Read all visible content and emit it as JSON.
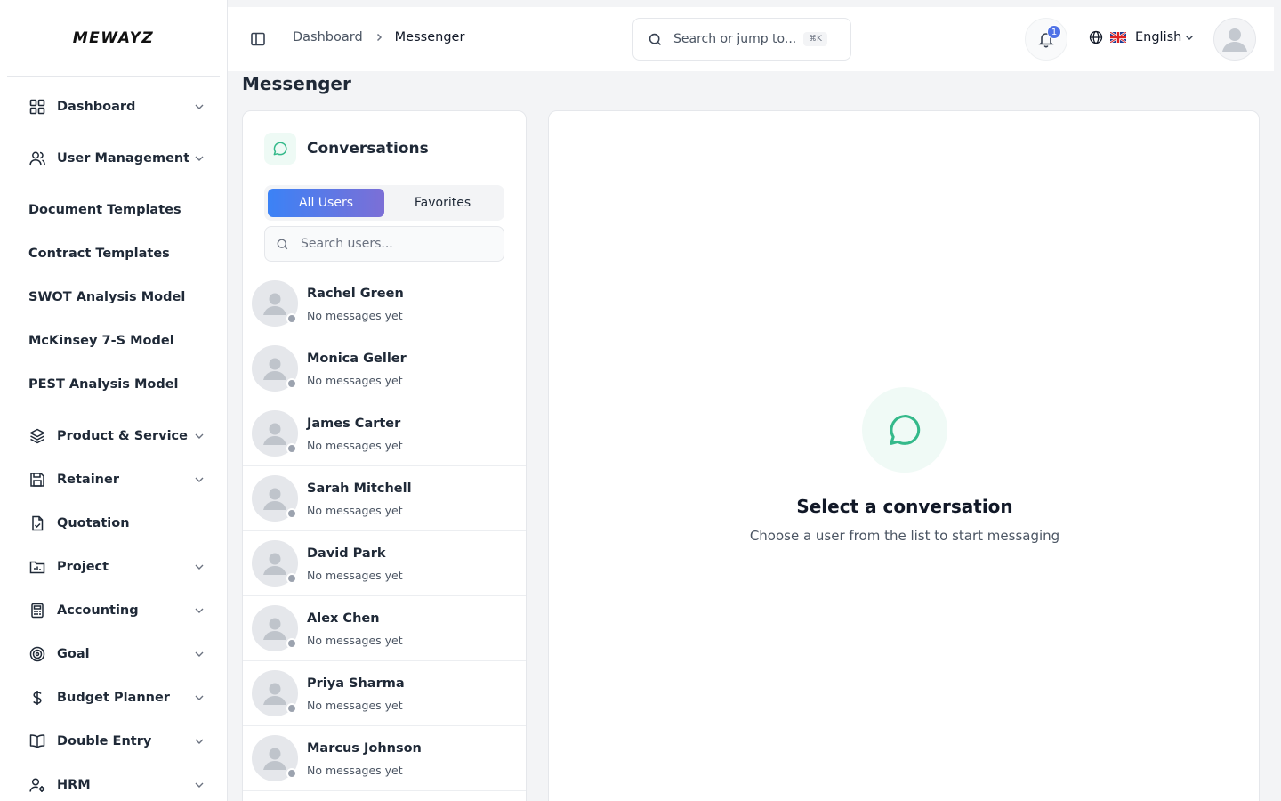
{
  "brand": {
    "name": "MEWAYZ"
  },
  "sidebar": {
    "items": [
      {
        "label": "Dashboard",
        "icon": "grid-icon",
        "has_chevron": true
      },
      {
        "label": "User Management",
        "icon": "users-icon",
        "has_chevron": true
      },
      {
        "label": "Document Templates",
        "icon": "",
        "has_chevron": false
      },
      {
        "label": "Contract Templates",
        "icon": "",
        "has_chevron": false
      },
      {
        "label": "SWOT Analysis Model",
        "icon": "",
        "has_chevron": false
      },
      {
        "label": "McKinsey 7-S Model",
        "icon": "",
        "has_chevron": false
      },
      {
        "label": "PEST Analysis Model",
        "icon": "",
        "has_chevron": false
      },
      {
        "label": "Product & Service",
        "icon": "layers-icon",
        "has_chevron": true
      },
      {
        "label": "Retainer",
        "icon": "save-icon",
        "has_chevron": true
      },
      {
        "label": "Quotation",
        "icon": "file-check-icon",
        "has_chevron": false
      },
      {
        "label": "Project",
        "icon": "folder-chart-icon",
        "has_chevron": true
      },
      {
        "label": "Accounting",
        "icon": "calculator-icon",
        "has_chevron": true
      },
      {
        "label": "Goal",
        "icon": "target-icon",
        "has_chevron": true
      },
      {
        "label": "Budget Planner",
        "icon": "dollar-icon",
        "has_chevron": true
      },
      {
        "label": "Double Entry",
        "icon": "book-icon",
        "has_chevron": true
      },
      {
        "label": "HRM",
        "icon": "user-gear-icon",
        "has_chevron": true
      }
    ]
  },
  "header": {
    "breadcrumb": [
      "Dashboard",
      "Messenger"
    ],
    "search_placeholder": "Search or jump to...",
    "search_shortcut": "⌘K",
    "notification_count": "1",
    "language": "English"
  },
  "page": {
    "title": "Messenger"
  },
  "conversations": {
    "title": "Conversations",
    "tabs": [
      {
        "label": "All Users",
        "active": true
      },
      {
        "label": "Favorites",
        "active": false
      }
    ],
    "search_placeholder": "Search users...",
    "users": [
      {
        "name": "Rachel Green",
        "last_message": "No messages yet"
      },
      {
        "name": "Monica Geller",
        "last_message": "No messages yet"
      },
      {
        "name": "James Carter",
        "last_message": "No messages yet"
      },
      {
        "name": "Sarah Mitchell",
        "last_message": "No messages yet"
      },
      {
        "name": "David Park",
        "last_message": "No messages yet"
      },
      {
        "name": "Alex Chen",
        "last_message": "No messages yet"
      },
      {
        "name": "Priya Sharma",
        "last_message": "No messages yet"
      },
      {
        "name": "Marcus Johnson",
        "last_message": "No messages yet"
      }
    ]
  },
  "chat": {
    "empty_title": "Select a conversation",
    "empty_subtitle": "Choose a user from the list to start messaging"
  },
  "colors": {
    "accent": "#3b82f6",
    "accent_end": "#7c6fd6",
    "chat_icon": "#34b98a",
    "badge": "#4f72e6"
  }
}
